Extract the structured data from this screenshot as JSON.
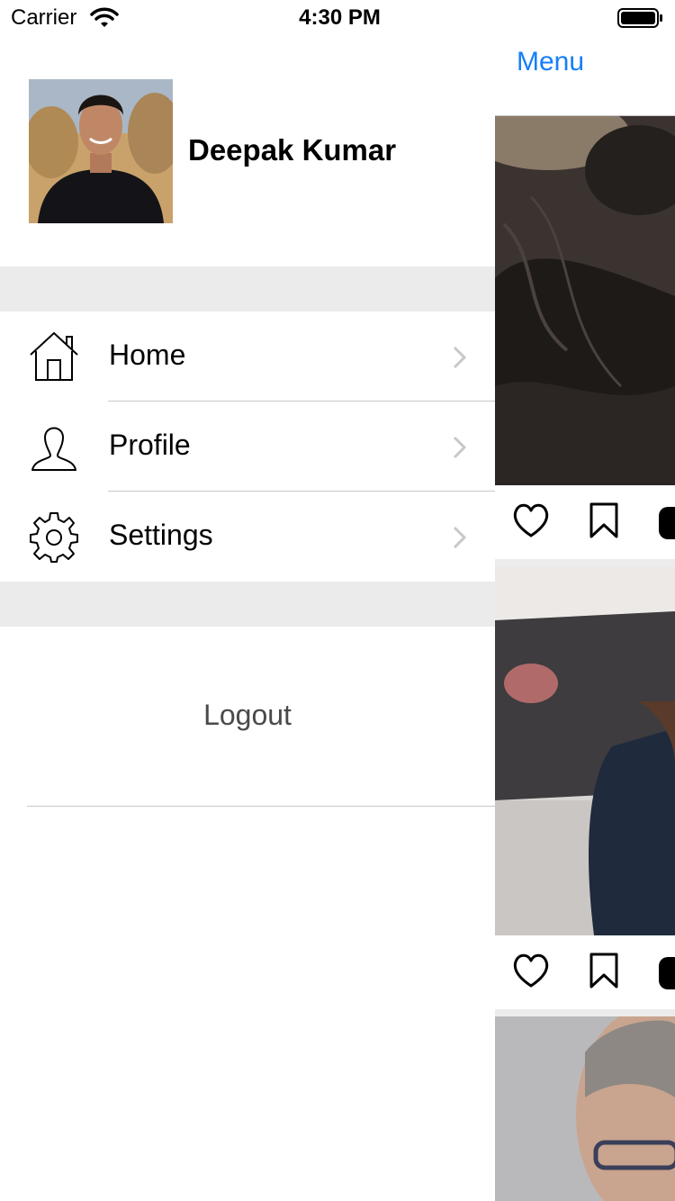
{
  "status_bar": {
    "carrier": "Carrier",
    "time": "4:30 PM",
    "wifi_icon": "wifi-icon",
    "battery_icon": "battery-icon"
  },
  "nav": {
    "menu_label": "Menu"
  },
  "drawer": {
    "user_name": "Deepak Kumar",
    "avatar_icon": "avatar-photo",
    "items": [
      {
        "label": "Home",
        "icon": "home-icon"
      },
      {
        "label": "Profile",
        "icon": "profile-icon"
      },
      {
        "label": "Settings",
        "icon": "gear-icon"
      }
    ],
    "logout_label": "Logout"
  },
  "feed": {
    "post_actions": [
      "heart-icon",
      "bookmark-icon",
      "comment-icon"
    ]
  },
  "colors": {
    "accent": "#157efb",
    "separator": "#ebebeb",
    "divider": "#c8c8cc",
    "chevron": "#c7c7cc"
  }
}
